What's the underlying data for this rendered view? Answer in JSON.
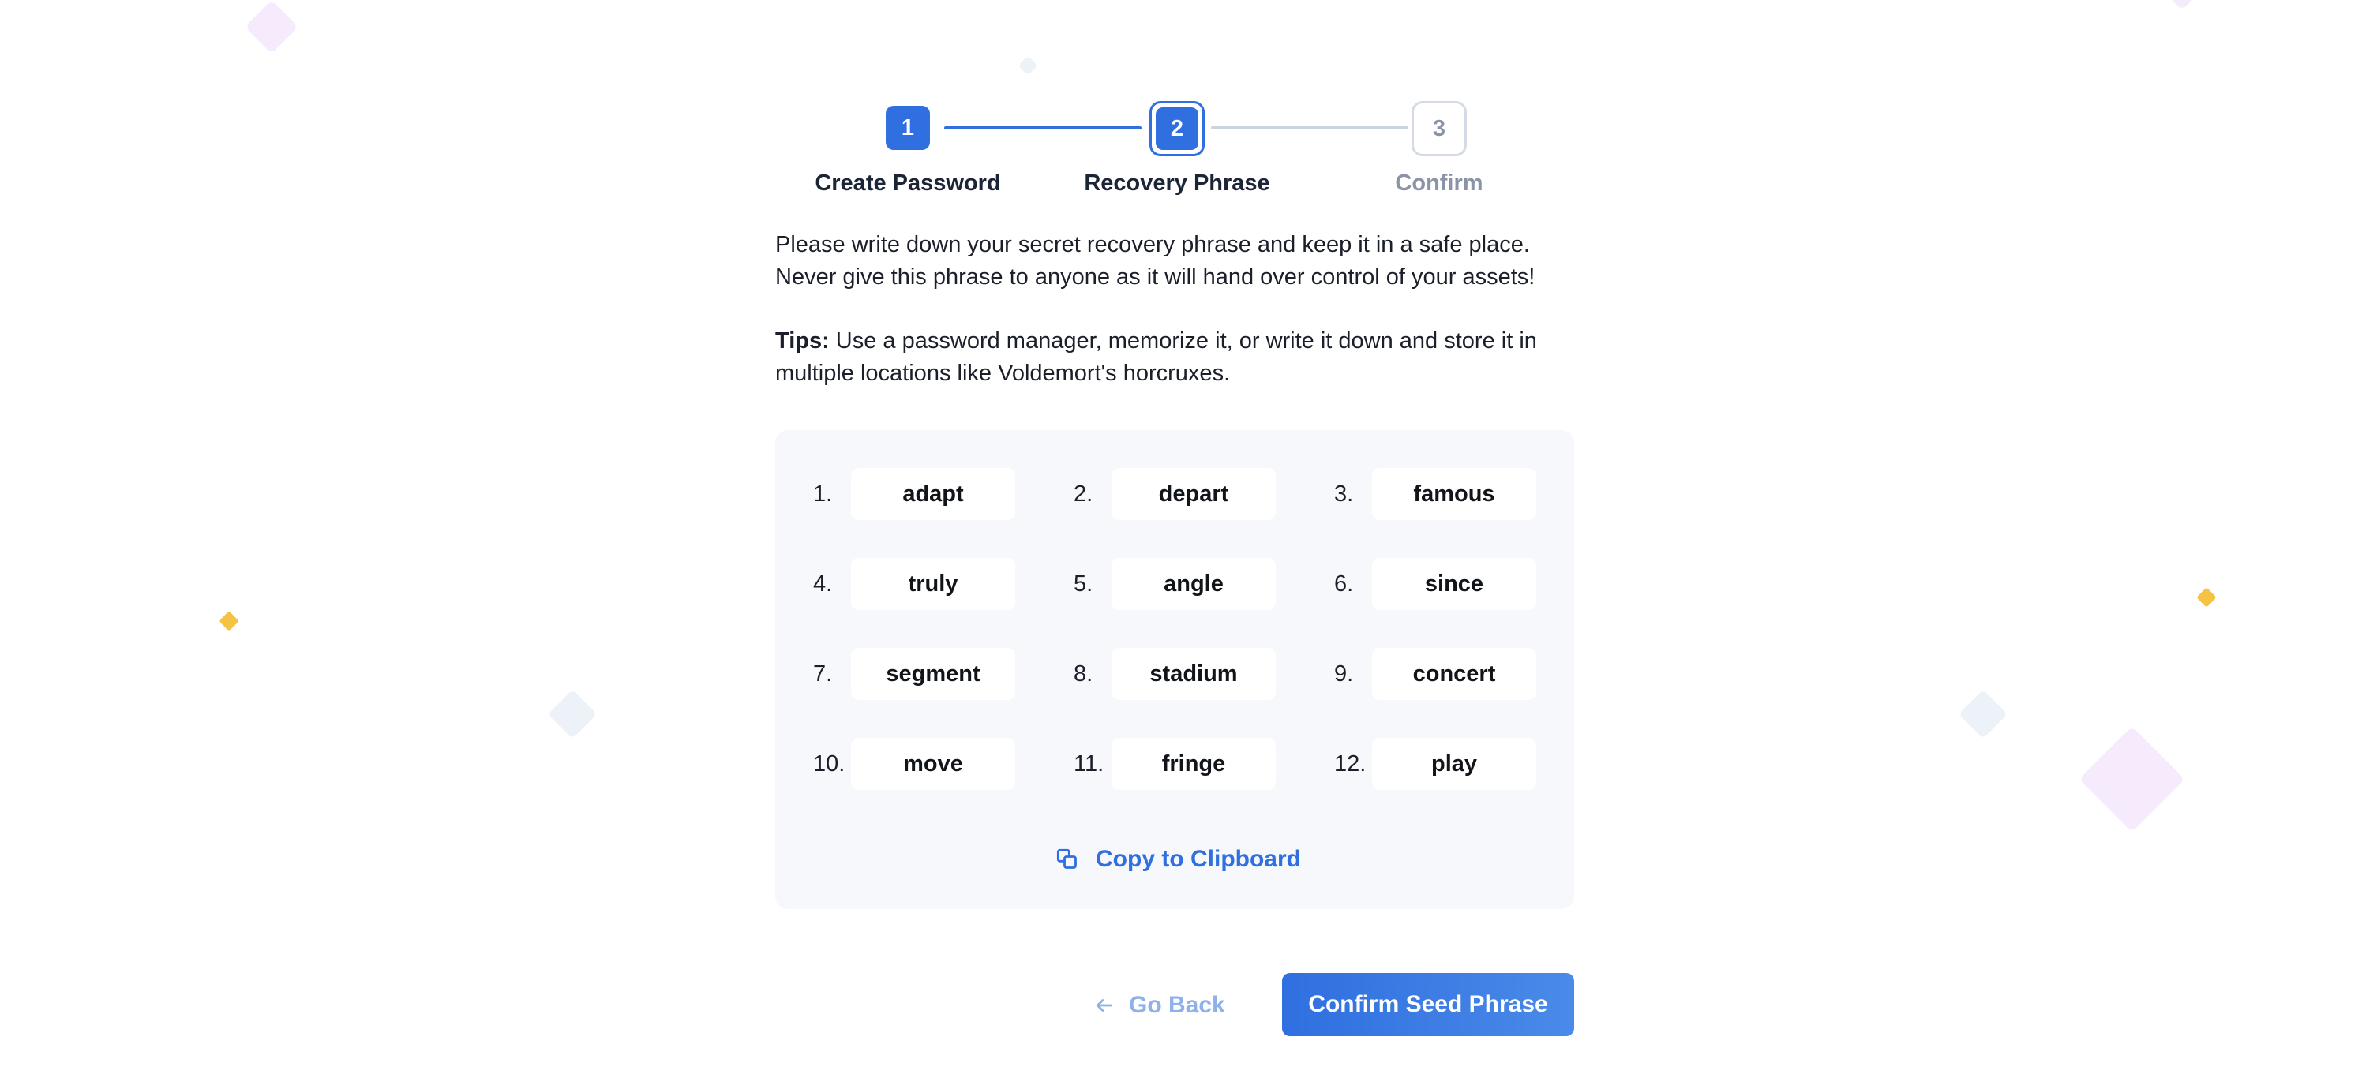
{
  "stepper": {
    "steps": [
      {
        "number": "1",
        "label": "Create Password",
        "state": "complete"
      },
      {
        "number": "2",
        "label": "Recovery Phrase",
        "state": "active"
      },
      {
        "number": "3",
        "label": "Confirm",
        "state": "upcoming"
      }
    ]
  },
  "intro": {
    "line1": "Please write down your secret recovery phrase and keep it in a safe place. Never give this phrase to anyone as it will hand over control of your assets!",
    "tips_label": "Tips:",
    "tips_text": " Use a password manager, memorize it, or write it down and store it in multiple locations like Voldemort's horcruxes."
  },
  "phrase": {
    "words": [
      {
        "num": "1.",
        "word": "adapt"
      },
      {
        "num": "2.",
        "word": "depart"
      },
      {
        "num": "3.",
        "word": "famous"
      },
      {
        "num": "4.",
        "word": "truly"
      },
      {
        "num": "5.",
        "word": "angle"
      },
      {
        "num": "6.",
        "word": "since"
      },
      {
        "num": "7.",
        "word": "segment"
      },
      {
        "num": "8.",
        "word": "stadium"
      },
      {
        "num": "9.",
        "word": "concert"
      },
      {
        "num": "10.",
        "word": "move"
      },
      {
        "num": "11.",
        "word": "fringe"
      },
      {
        "num": "12.",
        "word": "play"
      }
    ],
    "copy_label": "Copy to Clipboard",
    "copy_icon": "copy-icon"
  },
  "actions": {
    "back_label": "Go Back",
    "back_icon": "arrow-left-icon",
    "confirm_label": "Confirm Seed Phrase"
  },
  "colors": {
    "accent": "#2f6fe0",
    "muted": "#8a94a6",
    "card_bg": "#f7f8fb"
  }
}
